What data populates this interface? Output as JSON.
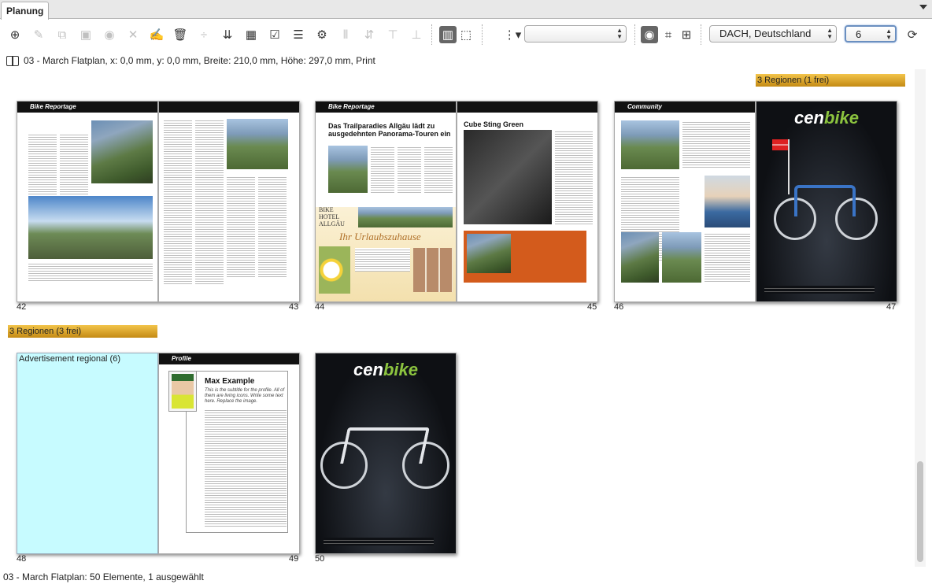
{
  "tab": {
    "label": "Planung"
  },
  "toolbar": {
    "region_select": "DACH, Deutschland",
    "count_select": "6",
    "filter_select": ""
  },
  "info": {
    "text": "03 - March Flatplan, x: 0,0 mm, y: 0,0 mm, Breite: 210,0 mm, Höhe: 297,0 mm, Print"
  },
  "regions": {
    "row1": "3 Regionen (1 frei)",
    "row2": "3 Regionen (3 frei)"
  },
  "spreads": {
    "s1": {
      "left_no": "42",
      "right_no": "43",
      "header": "Bike Reportage"
    },
    "s2": {
      "left_no": "44",
      "right_no": "45",
      "header": "Bike Reportage",
      "headline": "Das Trailparadies Allgäu lädt zu ausgedehnten Panorama-Touren ein",
      "right_title": "Cube Sting Green",
      "hotel_title": "BIKE HOTEL ALLGÄU",
      "hotel_slogan": "Ihr Urlaubszuhause"
    },
    "s3": {
      "left_no": "46",
      "right_no": "47",
      "header": "Community",
      "ad_brand_a": "cen",
      "ad_brand_b": "bike"
    },
    "s4": {
      "left_no": "48",
      "right_no": "49",
      "adv_label": "Advertisement regional (6)",
      "header": "Profile",
      "profile_name": "Max Example",
      "profile_sub": "This is the subtitle for the profile. All of them are living icons. Write some text here. Replace the image."
    },
    "s5": {
      "no": "50",
      "ad_brand_a": "cen",
      "ad_brand_b": "bike"
    }
  },
  "status": {
    "text": "03 - March Flatplan: 50 Elemente, 1 ausgewählt"
  },
  "icons": [
    "add-icon",
    "edit-icon",
    "copy-icon",
    "save-icon",
    "eye-icon",
    "delete-x-icon",
    "sign-icon",
    "trash-icon",
    "split-icon",
    "merge-icon",
    "grid-icon",
    "checkbox-icon",
    "list-icon",
    "gear-icon",
    "align-icons",
    "filter-icon",
    "view-eye-icon",
    "crop-icon",
    "hierarchy-icon",
    "refresh-icon"
  ]
}
